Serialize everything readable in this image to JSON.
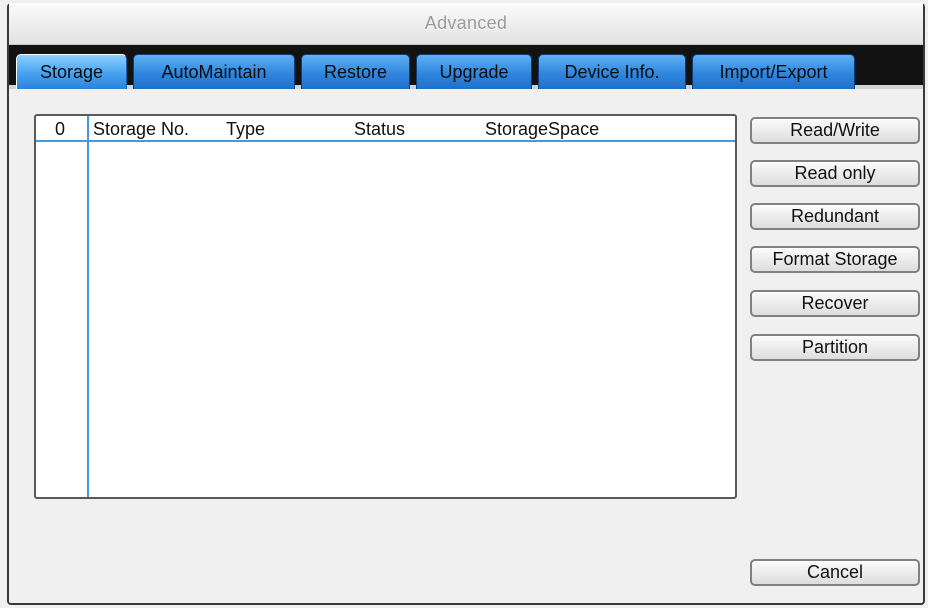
{
  "window": {
    "title": "Advanced"
  },
  "tabs": [
    {
      "label": "Storage",
      "active": true
    },
    {
      "label": "AutoMaintain",
      "active": false
    },
    {
      "label": "Restore",
      "active": false
    },
    {
      "label": "Upgrade",
      "active": false
    },
    {
      "label": "Device Info.",
      "active": false
    },
    {
      "label": "Import/Export",
      "active": false
    }
  ],
  "storage_list": {
    "columns": [
      "0",
      "Storage No.",
      "Type",
      "Status",
      "StorageSpace"
    ],
    "rows": []
  },
  "actions": {
    "read_write": "Read/Write",
    "read_only": "Read only",
    "redundant": "Redundant",
    "format_storage": "Format Storage",
    "recover": "Recover",
    "partition": "Partition"
  },
  "footer": {
    "cancel": "Cancel"
  },
  "colors": {
    "tab_blue": "#2f86de",
    "active_tab_blue": "#46a2ee",
    "grid_blue": "#3f9be6",
    "tabstrip_black": "#121212"
  }
}
